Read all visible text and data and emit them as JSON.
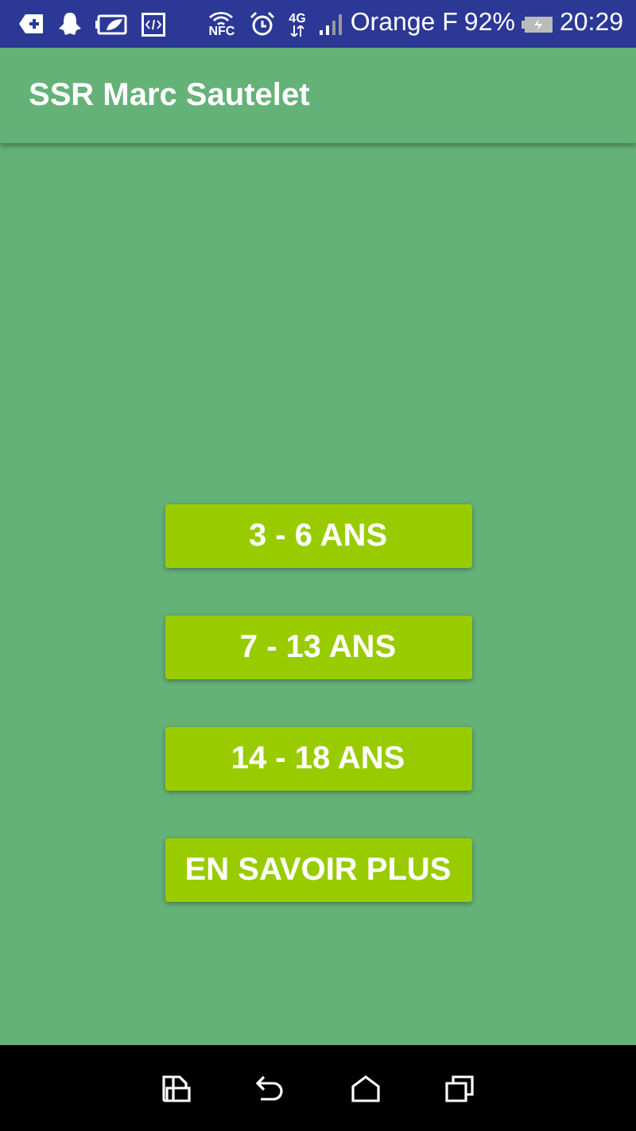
{
  "status_bar": {
    "nfc": "NFC",
    "network": "4G",
    "carrier": "Orange F",
    "battery": "92%",
    "time": "20:29"
  },
  "app_bar": {
    "title": "SSR Marc Sautelet"
  },
  "buttons": [
    {
      "label": "3 - 6 ANS"
    },
    {
      "label": "7 - 13 ANS"
    },
    {
      "label": "14 - 18 ANS"
    },
    {
      "label": "EN SAVOIR PLUS"
    }
  ]
}
